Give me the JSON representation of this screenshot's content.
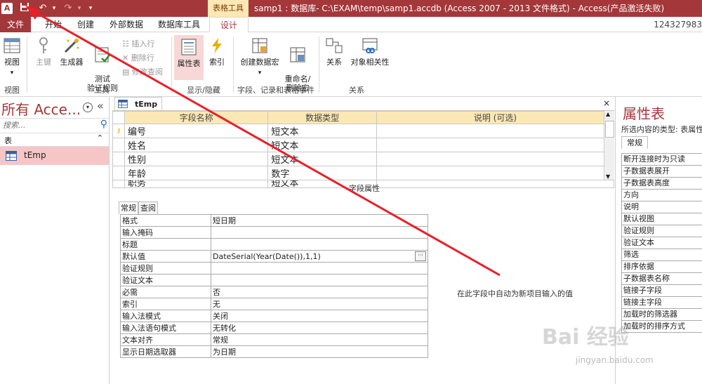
{
  "title_bar": {
    "app_icon": "A",
    "context_tab": "表格工具",
    "window_title": "samp1 : 数据库- C:\\EXAM\\temp\\samp1.accdb (Access 2007 - 2013 文件格式) -  Access(产品激活失败)"
  },
  "tabs": {
    "file": "文件",
    "home": "开始",
    "create": "创建",
    "external": "外部数据",
    "dbtools": "数据库工具",
    "design": "设计"
  },
  "account": "124327983",
  "ribbon": {
    "view": "视图",
    "view_group": "视图",
    "primary_key": "主键",
    "builder": "生成器",
    "test_rules": "测试\n验证规则",
    "insert_rows": "插入行",
    "delete_rows": "删除行",
    "modify_lookups": "修改查阅",
    "tools_group": "工具",
    "property_sheet": "属性表",
    "indexes": "索引",
    "show_hide_group": "显示/隐藏",
    "create_macro": "创建数据宏",
    "rename_macro": "重命名/\n删除宏",
    "field_events_group": "字段、记录和表格事件",
    "relationships": "关系",
    "object_deps": "对象相关性",
    "relationships_group": "关系"
  },
  "nav": {
    "title": "所有 Acce...",
    "search_placeholder": "搜索...",
    "section": "表",
    "items": [
      "tEmp"
    ]
  },
  "doc": {
    "tab": "tEmp",
    "headers": [
      "字段名称",
      "数据类型",
      "说明 (可选)"
    ],
    "rows": [
      {
        "name": "编号",
        "type": "短文本",
        "desc": ""
      },
      {
        "name": "姓名",
        "type": "短文本",
        "desc": ""
      },
      {
        "name": "性别",
        "type": "短文本",
        "desc": ""
      },
      {
        "name": "年龄",
        "type": "数字",
        "desc": ""
      },
      {
        "name": "职务",
        "type": "短文本",
        "desc": ""
      }
    ],
    "field_props_caption": "字段属性",
    "subtabs": [
      "常规",
      "查阅"
    ],
    "general_props": [
      {
        "label": "格式",
        "value": "短日期"
      },
      {
        "label": "输入掩码",
        "value": ""
      },
      {
        "label": "标题",
        "value": ""
      },
      {
        "label": "默认值",
        "value": "DateSerial(Year(Date()),1,1)"
      },
      {
        "label": "验证规则",
        "value": ""
      },
      {
        "label": "验证文本",
        "value": ""
      },
      {
        "label": "必需",
        "value": "否"
      },
      {
        "label": "索引",
        "value": "无"
      },
      {
        "label": "输入法模式",
        "value": "关闭"
      },
      {
        "label": "输入法语句模式",
        "value": "无转化"
      },
      {
        "label": "文本对齐",
        "value": "常规"
      },
      {
        "label": "显示日期选取器",
        "value": "为日期"
      }
    ],
    "hint": "在此字段中自动为新项目输入的值"
  },
  "property_sheet": {
    "title": "属性表",
    "selection_type": "所选内容的类型: 表属性",
    "tab": "常规",
    "props": [
      "断开连接时为只读",
      "子数据表展开",
      "子数据表高度",
      "方向",
      "说明",
      "默认视图",
      "验证规则",
      "验证文本",
      "筛选",
      "排序依据",
      "子数据表名称",
      "链接子字段",
      "链接主字段",
      "加载时的筛选器",
      "加载时的排序方式"
    ]
  },
  "watermark": "Bai 经验",
  "watermark_sub": "jingyan.baidu.com",
  "colors": {
    "accent": "#a4373a",
    "context": "#fbe8b4",
    "arrow": "#e8202a"
  }
}
